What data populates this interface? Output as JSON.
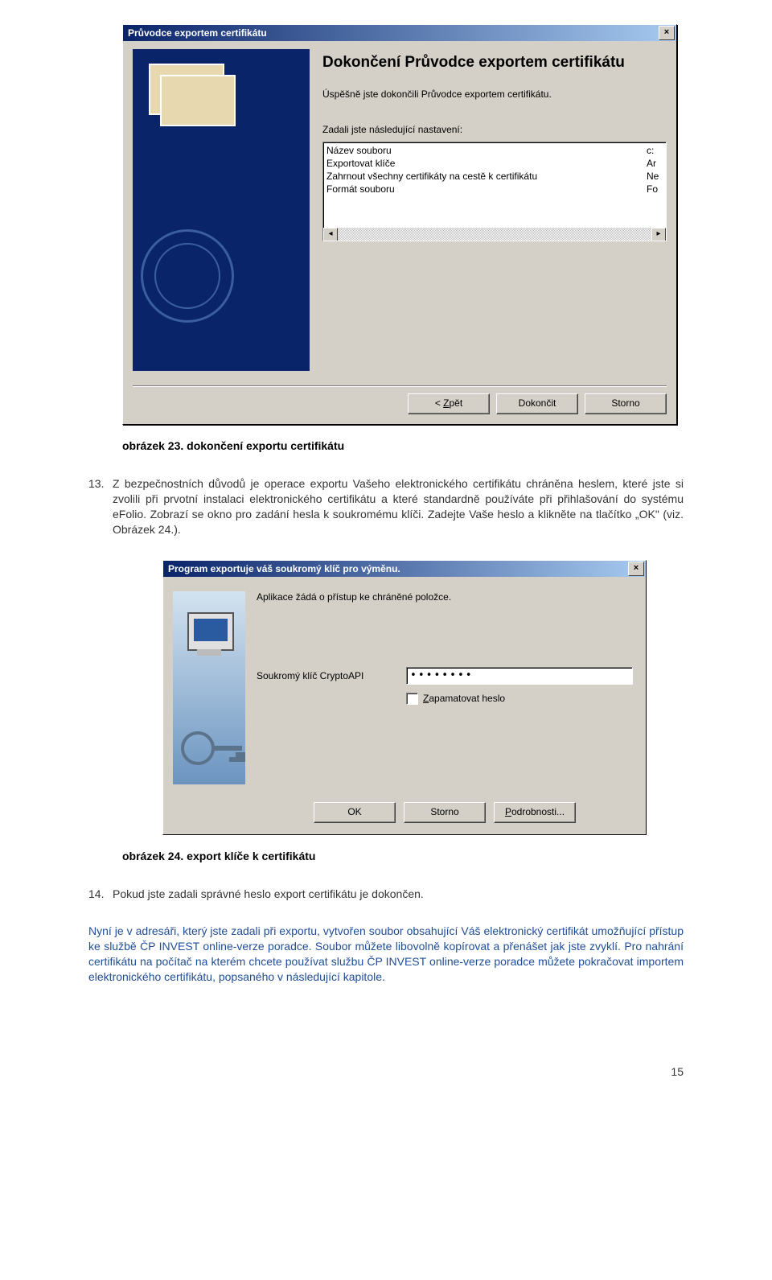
{
  "dialog1": {
    "title": "Průvodce exportem certifikátu",
    "heading": "Dokončení Průvodce exportem certifikátu",
    "success_text": "Úspěšně jste dokončili Průvodce exportem certifikátu.",
    "settings_label": "Zadali jste následující nastavení:",
    "list": [
      {
        "label": "Název souboru",
        "value": "c:"
      },
      {
        "label": "Exportovat klíče",
        "value": "Ar"
      },
      {
        "label": "Zahrnout všechny certifikáty na cestě k certifikátu",
        "value": "Ne"
      },
      {
        "label": "Formát souboru",
        "value": "Fo"
      }
    ],
    "buttons": {
      "back_prefix": "< ",
      "back_u": "Z",
      "back_suffix": "pět",
      "finish": "Dokončit",
      "cancel": "Storno"
    }
  },
  "caption1": "obrázek 23. dokončení exportu certifikátu",
  "step13": {
    "num": "13.",
    "text": "Z bezpečnostních důvodů je operace exportu Vašeho elektronického certifikátu chráněna heslem, které jste si zvolili při prvotní instalaci elektronického certifikátu a které standardně používáte při přihlašování do systému eFolio. Zobrazí se okno pro zadání hesla k soukromému klíči. Zadejte Vaše heslo a klikněte na tlačítko „OK\" (viz. Obrázek 24.)."
  },
  "dialog2": {
    "title": "Program exportuje váš soukromý klíč pro výměnu.",
    "access_text": "Aplikace žádá o přístup ke chráněné položce.",
    "field_label": "Soukromý klíč CryptoAPI",
    "password_mask": "••••••••",
    "remember_u": "Z",
    "remember_suffix": "apamatovat heslo",
    "buttons": {
      "ok": "OK",
      "cancel": "Storno",
      "details_u": "P",
      "details_suffix": "odrobnosti..."
    }
  },
  "caption2": "obrázek 24. export klíče k certifikátu",
  "step14": {
    "num": "14.",
    "text": "Pokud jste zadali správné heslo export certifikátu je dokončen."
  },
  "closing": "Nyní je v adresáři, který jste zadali při exportu, vytvořen soubor obsahující Váš elektronický certifikát umožňující přístup ke službě ČP INVEST online-verze poradce. Soubor můžete libovolně kopírovat a přenášet jak jste zvyklí. Pro nahrání certifikátu na počítač na kterém chcete používat službu ČP INVEST online-verze poradce můžete pokračovat importem elektronického certifikátu, popsaného v následující kapitole.",
  "page_number": "15"
}
